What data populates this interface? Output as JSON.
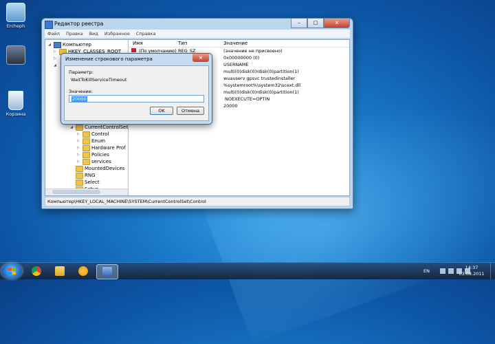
{
  "desktop": {
    "icons": [
      {
        "label": "Ercheph"
      },
      {
        "label": ""
      },
      {
        "label": "Корзина"
      }
    ]
  },
  "window": {
    "title": "Редактор реестра",
    "menu": [
      "Файл",
      "Правка",
      "Вид",
      "Избранное",
      "Справка"
    ],
    "tree": {
      "root": "Компьютер",
      "hkcr": "HKEY_CLASSES_ROOT",
      "ccs": "CurrentControlSet",
      "children": [
        "Control",
        "Enum",
        "Hardware Prof",
        "Policies",
        "services"
      ],
      "siblings": [
        "MountedDevices",
        "RNG",
        "Select",
        "Setup"
      ]
    },
    "columns": {
      "name": "Имя",
      "type": "Тип",
      "value": "Значение"
    },
    "rows": [
      {
        "name": "(По умолчанию)",
        "type": "REG_SZ",
        "value": "(значение не присвоено)"
      },
      {
        "name": "",
        "type": "",
        "value": "0x00000000 (0)"
      },
      {
        "name": "",
        "type": "",
        "value": "USERNAME"
      },
      {
        "name": "",
        "type": "",
        "value": "multi(0)disk(0)rdisk(0)partition(1)"
      },
      {
        "name": "",
        "type": "",
        "value": "wuauserv gpsvc trustedinstaller"
      },
      {
        "name": "",
        "type": "",
        "value": "%systemroot%\\system32\\scext.dll"
      },
      {
        "name": "",
        "type": "",
        "value": "multi(0)disk(0)rdisk(0)partition(1)"
      },
      {
        "name": "",
        "type": "",
        "value": "NOEXECUTE=OPTIN"
      },
      {
        "name": "",
        "type": "",
        "value": "20000"
      }
    ],
    "status": "Компьютер\\HKEY_LOCAL_MACHINE\\SYSTEM\\CurrentControlSet\\Control"
  },
  "dialog": {
    "title": "Изменение строкового параметра",
    "param_label": "Параметр:",
    "param_value": "WaitToKillServiceTimeout",
    "value_label": "Значение:",
    "value": "20000",
    "ok": "OK",
    "cancel": "Отмена"
  },
  "taskbar": {
    "lang": "EN",
    "time": "14:37",
    "date": "03.08.2011"
  }
}
